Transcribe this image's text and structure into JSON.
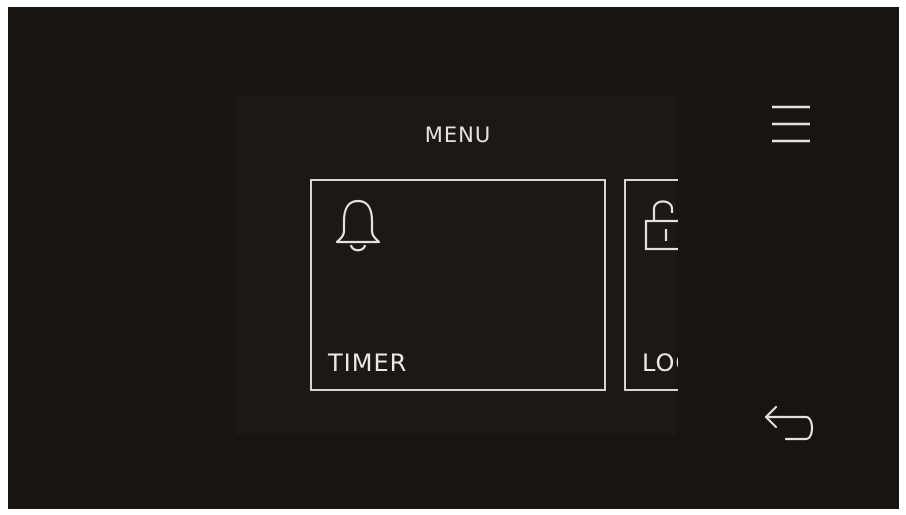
{
  "screen": {
    "title": "MENU"
  },
  "tiles": [
    {
      "label": "TIMER",
      "icon": "bell-icon"
    },
    {
      "label": "LOCK",
      "icon": "unlock-icon"
    }
  ],
  "navigation": {
    "menu_icon": "hamburger-menu-icon",
    "back_icon": "back-arrow-icon"
  },
  "colors": {
    "background": "#181412",
    "foreground": "#e6e1dc"
  }
}
